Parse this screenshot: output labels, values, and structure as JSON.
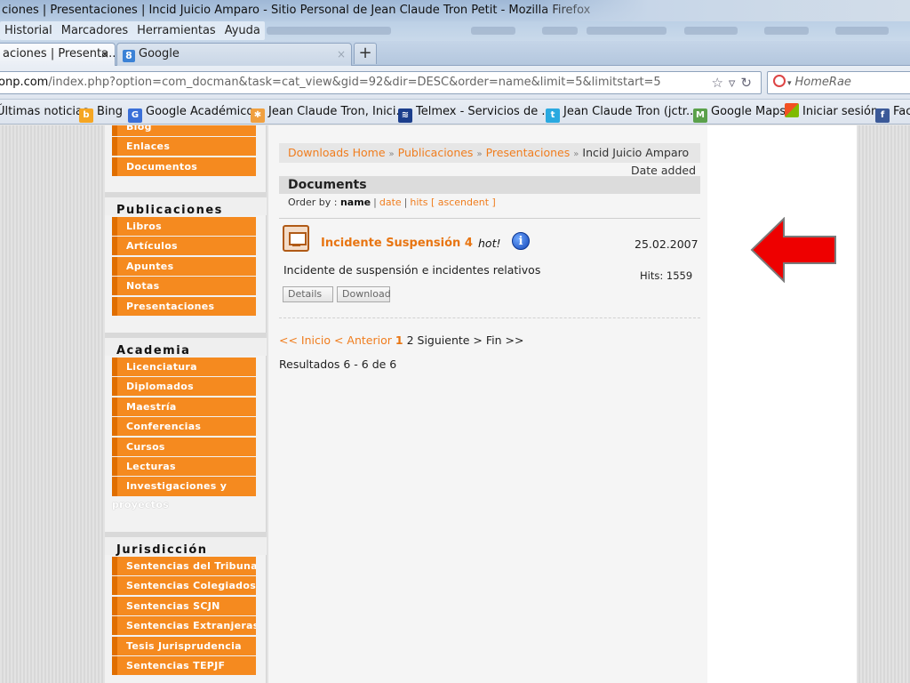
{
  "window": {
    "title": "ciones | Presentaciones | Incid Juicio Amparo - Sitio Personal de Jean Claude Tron Petit - Mozilla Firefox"
  },
  "menubar": {
    "items": [
      "Historial",
      "Marcadores",
      "Herramientas",
      "Ayuda"
    ]
  },
  "tabs": [
    {
      "label": "aciones | Presenta...",
      "close": "×"
    },
    {
      "label": "Google",
      "close": "×",
      "favicon": "8"
    }
  ],
  "newtab_label": "+",
  "address": {
    "host": "onp.com",
    "path": "/index.php?option=com_docman&task=cat_view&gid=92&dir=DESC&order=name&limit=5&limitstart=5"
  },
  "search": {
    "placeholder": "HomeRae"
  },
  "bookmarks": [
    {
      "label": "Últimas noticias",
      "icon": "",
      "color": ""
    },
    {
      "label": "Bing",
      "icon": "b",
      "color": "#f5a623"
    },
    {
      "label": "Google Académico",
      "icon": "G",
      "color": "#3a6fd8"
    },
    {
      "label": "Jean Claude Tron, Inici...",
      "icon": "✱",
      "color": "#f0a040"
    },
    {
      "label": "Telmex - Servicios de ...",
      "icon": "≋",
      "color": "#1c3e8c"
    },
    {
      "label": "Jean Claude Tron (jctr...",
      "icon": "t",
      "color": "#29a9e0"
    },
    {
      "label": "Google Maps",
      "icon": "M",
      "color": "#5aa04a"
    },
    {
      "label": "Iniciar sesión",
      "icon": "",
      "color": "#e94e2b"
    },
    {
      "label": "Fac",
      "icon": "f",
      "color": "#3b5998"
    }
  ],
  "sidebar": {
    "top_items": [
      "Blog",
      "Enlaces",
      "Documentos"
    ],
    "sections": [
      {
        "title": "Publicaciones",
        "items": [
          "Libros",
          "Artículos",
          "Apuntes",
          "Notas",
          "Presentaciones"
        ]
      },
      {
        "title": "Academia",
        "items": [
          "Licenciatura",
          "Diplomados",
          "Maestría",
          "Conferencias",
          "Cursos",
          "Lecturas",
          "Investigaciones y"
        ],
        "wrap_tail": "proyectos"
      },
      {
        "title": "Jurisdicción",
        "items": [
          "Sentencias del Tribunal",
          "Sentencias Colegiados",
          "Sentencias SCJN",
          "Sentencias Extranjeras",
          "Tesis Jurisprudencia",
          "Sentencias TEPJF"
        ]
      }
    ]
  },
  "main": {
    "breadcrumb": [
      "Downloads Home",
      "Publicaciones",
      "Presentaciones",
      "Incid Juicio Amparo"
    ],
    "breadcrumb_sep": "»",
    "date_added_label": "Date added",
    "documents_title": "Documents",
    "order_by": {
      "label": "Order by :",
      "options": [
        "name",
        "date",
        "hits"
      ],
      "direction": "[ ascendent ]"
    },
    "document": {
      "title": "Incidente Suspensión 4",
      "badge": "hot!",
      "info": "i",
      "date": "25.02.2007",
      "description": "Incidente de suspensión e incidentes relativos",
      "hits": "Hits: 1559",
      "details_button": "Details",
      "download_button": "Download"
    },
    "pagination": {
      "first": "<< Inicio",
      "prev": "< Anterior",
      "current": "1",
      "page2": "2",
      "next": "Siguiente >",
      "last": "Fin >>"
    },
    "results": "Resultados 6 - 6 de 6"
  },
  "colors": {
    "accent_orange": "#f58a1f",
    "link_orange": "#f07d1e",
    "arrow_red": "#ee0000"
  }
}
